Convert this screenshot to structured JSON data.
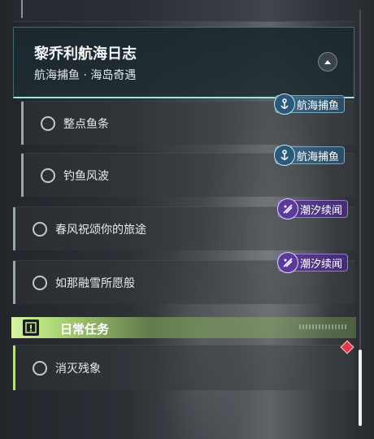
{
  "header": {
    "title": "黎乔利航海日志",
    "subtitle": "航海捕鱼 · 海岛奇遇",
    "collapse_icon": "chevron-up-icon"
  },
  "quests": [
    {
      "label": "整点鱼条",
      "badge": "航海捕鱼",
      "badge_type": "fishing",
      "badge_icon": "anchor-icon"
    },
    {
      "label": "钓鱼风波",
      "badge": "航海捕鱼",
      "badge_type": "fishing",
      "badge_icon": "anchor-icon"
    },
    {
      "label": "春风祝颂你的旅途",
      "badge": "潮汐续闻",
      "badge_type": "tide",
      "badge_icon": "tide-icon"
    },
    {
      "label": "如那融雪所愿般",
      "badge": "潮汐续闻",
      "badge_type": "tide",
      "badge_icon": "tide-icon"
    }
  ],
  "daily_section": {
    "title": "日常任务",
    "icon": "alert-square-icon"
  },
  "daily_quests": [
    {
      "label": "消灭残象",
      "marker_icon": "red-diamond-icon"
    }
  ],
  "colors": {
    "header_border": "#9fe3e3",
    "fishing_badge": "#2b5a78",
    "tide_badge": "#5a3a9a",
    "daily_accent": "#b8e07f",
    "tracked_marker": "#e23a4a"
  }
}
